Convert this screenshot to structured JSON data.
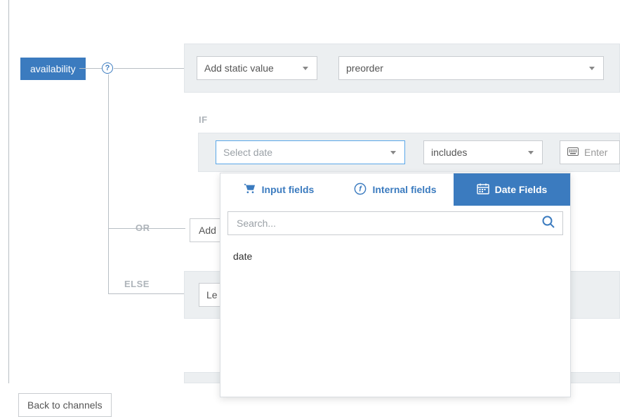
{
  "tag": {
    "label": "availability"
  },
  "help": {
    "symbol": "?"
  },
  "row1": {
    "add_static": "Add static value",
    "preorder": "preorder"
  },
  "labels": {
    "if": "IF",
    "or": "OR",
    "else": "ELSE"
  },
  "if_row": {
    "select_date": "Select date",
    "includes": "includes",
    "enter": "Enter "
  },
  "or_row": {
    "add": "Add "
  },
  "else_row": {
    "le": "Le"
  },
  "popup": {
    "tabs": {
      "input": "Input fields",
      "internal": "Internal fields",
      "date": "Date Fields"
    },
    "search_placeholder": "Search...",
    "items": {
      "0": "date"
    }
  },
  "footer": {
    "back": "Back to channels"
  }
}
